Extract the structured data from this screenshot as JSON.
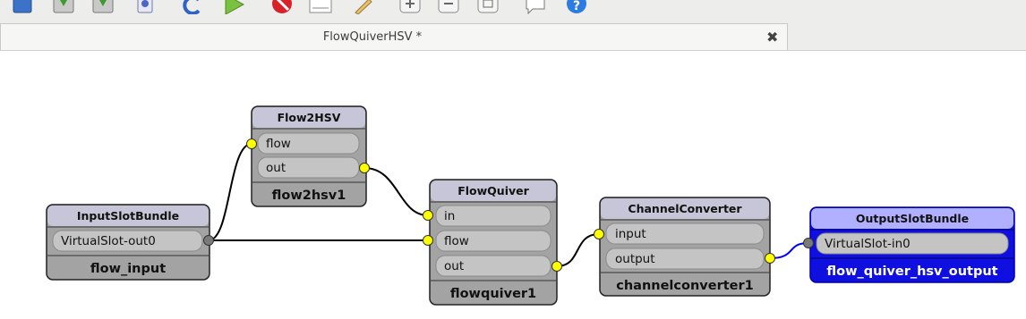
{
  "tab": {
    "title": "FlowQuiverHSV *"
  },
  "toolbar": {
    "icons": [
      "window-icon",
      "save-icon",
      "save-as-icon",
      "link-icon",
      "refresh-icon",
      "run-icon",
      "stop-icon",
      "blank-icon",
      "brush-icon",
      "zoom-in-icon",
      "zoom-out-icon",
      "zoom-fit-icon",
      "help-balloon-icon",
      "help-icon"
    ]
  },
  "nodes": {
    "input_slot_bundle": {
      "type": "InputSlotBundle",
      "port": "VirtualSlot-out0",
      "name": "flow_input"
    },
    "flow2hsv": {
      "type": "Flow2HSV",
      "ports": [
        "flow",
        "out"
      ],
      "name": "flow2hsv1"
    },
    "flowquiver": {
      "type": "FlowQuiver",
      "ports": [
        "in",
        "flow",
        "out"
      ],
      "name": "flowquiver1"
    },
    "channelconverter": {
      "type": "ChannelConverter",
      "ports": [
        "input",
        "output"
      ],
      "name": "channelconverter1"
    },
    "output_slot_bundle": {
      "type": "OutputSlotBundle",
      "port": "VirtualSlot-in0",
      "name": "flow_quiver_hsv_output"
    }
  },
  "colors": {
    "node_fill": "#a3a3a3",
    "node_header": "#c6c6d8",
    "port_fill": "#c4c4c4",
    "output_node_fill": "#0f0fe0",
    "output_node_header": "#b0b0ff",
    "connector_yellow": "#ffff00",
    "connector_gray": "#7a7a7a",
    "edge_default": "#000000",
    "edge_output": "#0000ff"
  }
}
